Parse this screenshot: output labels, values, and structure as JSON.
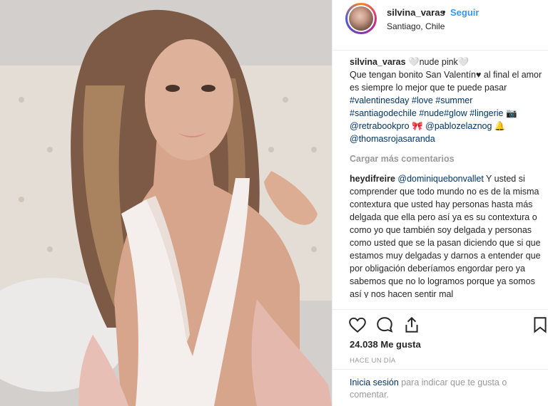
{
  "post": {
    "username": "silvina_varas",
    "separator": "•",
    "follow_label": "Seguir",
    "location": "Santiago, Chile"
  },
  "caption": {
    "username": "silvina_varas",
    "title": " 🤍nude pink🤍",
    "line1": "Que tengan bonito San Valentín♥ al final el amor es siempre lo mejor que te puede pasar",
    "hashtags": [
      "#valentinesday",
      "#love",
      "#summer",
      "#santiagodechile",
      "#nude",
      "#glow",
      "#lingerie"
    ],
    "hashtags_emoji": "📷",
    "mention1": "@retrabookpro",
    "mention1_emoji": "🎀",
    "mention2": "@pablozelaznog",
    "mention2_emoji": "🔔",
    "mention3": "@thomasrojasaranda"
  },
  "load_more": "Cargar más comentarios",
  "comment": {
    "username": "heydifreire",
    "mention": "@dominiquebonvallet",
    "text": " Y usted si comprender que todo mundo no es de la misma contextura que usted hay personas hasta más delgada que ella pero así ya es su contextura o como yo que también soy delgada y personas como usted que se la pasan diciendo que si que estamos muy delgadas y darnos a entender que por obligación deberíamos engordar pero ya sabemos que no lo logramos porque ya somos así y nos hacen sentir mal"
  },
  "likes": "24.038 Me gusta",
  "timestamp": "HACE UN DÍA",
  "login": {
    "link": "Inicia sesión",
    "text": " para indicar que te gusta o comentar."
  },
  "icons": [
    "heart-icon",
    "comment-icon",
    "share-icon",
    "bookmark-icon"
  ]
}
